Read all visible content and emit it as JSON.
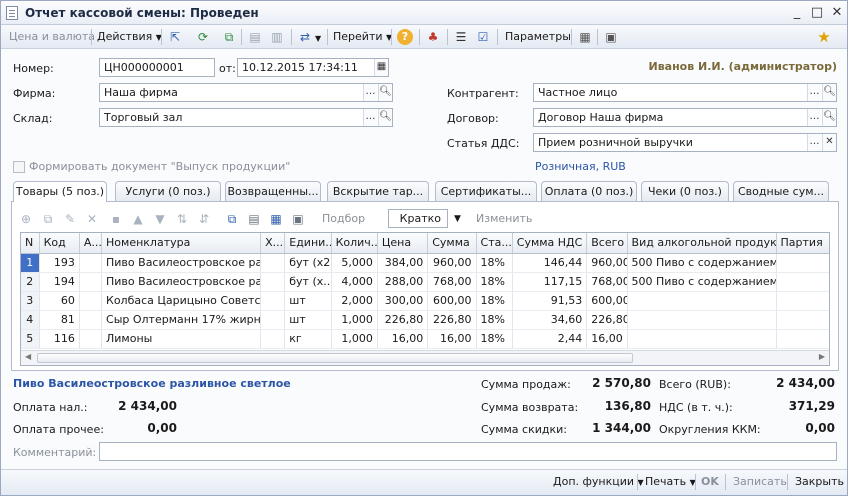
{
  "window": {
    "title": "Отчет кассовой смены: Проведен",
    "controls": {
      "minimize": "_",
      "maximize": "□",
      "close": "✕"
    }
  },
  "toolbar": {
    "price_currency": "Цена и валюта",
    "actions": "Действия",
    "goto": "Перейти",
    "parameters": "Параметры"
  },
  "header": {
    "number_label": "Номер:",
    "number_value": "ЦН000000001",
    "date_label": "от:",
    "date_value": "10.12.2015 17:34:11",
    "firm_label": "Фирма:",
    "firm_value": "Наша фирма",
    "warehouse_label": "Склад:",
    "warehouse_value": "Торговый зал",
    "user": "Иванов И.И. (администратор)",
    "counterparty_label": "Контрагент:",
    "counterparty_value": "Частное лицо",
    "contract_label": "Договор:",
    "contract_value": "Договор Наша фирма",
    "dds_label": "Статья ДДС:",
    "dds_value": "Прием розничной выручки",
    "checkbox_label": "Формировать документ \"Выпуск продукции\"",
    "price_type": "Розничная, RUB"
  },
  "tabs": [
    {
      "label": "Товары (5 поз.)"
    },
    {
      "label": "Услуги (0 поз.)"
    },
    {
      "label": "Возвращенны..."
    },
    {
      "label": "Вскрытие тар..."
    },
    {
      "label": "Сертификаты..."
    },
    {
      "label": "Оплата (0 поз.)"
    },
    {
      "label": "Чеки (0 поз.)"
    },
    {
      "label": "Сводные сум..."
    }
  ],
  "subtoolbar": {
    "selection": "Подбор",
    "view_mode": "Кратко",
    "change": "Изменить"
  },
  "table": {
    "columns": [
      "N",
      "Код",
      "А...",
      "Номенклатура",
      "Х...",
      "Едини...",
      "Колич...",
      "Цена",
      "Сумма",
      "Ста...",
      "Сумма НДС",
      "Всего",
      "Вид алкогольной продукц...",
      "Партия"
    ],
    "rows": [
      [
        "1",
        "193",
        "",
        "Пиво Василеостровское ра...",
        "",
        "бут (x2)",
        "5,000",
        "384,00",
        "960,00",
        "18%",
        "146,44",
        "960,00",
        "500 Пиво с содержанием ...",
        ""
      ],
      [
        "2",
        "194",
        "",
        "Пиво Василеостровское ра...",
        "",
        "бут (х...",
        "4,000",
        "288,00",
        "768,00",
        "18%",
        "117,15",
        "768,00",
        "500 Пиво с содержанием ...",
        ""
      ],
      [
        "3",
        "60",
        "",
        "Колбаса Царицыно Советск...",
        "",
        "шт",
        "2,000",
        "300,00",
        "600,00",
        "18%",
        "91,53",
        "600,00",
        "",
        ""
      ],
      [
        "4",
        "81",
        "",
        "Сыр Олтерманн 17% жирн н...",
        "",
        "шт",
        "1,000",
        "226,80",
        "226,80",
        "18%",
        "34,60",
        "226,80",
        "",
        ""
      ],
      [
        "5",
        "116",
        "",
        "Лимоны",
        "",
        "кг",
        "1,000",
        "16,00",
        "16,00",
        "18%",
        "2,44",
        "16,00",
        "",
        ""
      ]
    ]
  },
  "totals": {
    "product_name": "Пиво Василеостровское разливное светлое",
    "cash_label": "Оплата нал.:",
    "cash_value": "2 434,00",
    "other_label": "Оплата прочее:",
    "other_value": "0,00",
    "sales_label": "Сумма продаж:",
    "sales_value": "2 570,80",
    "return_label": "Сумма возврата:",
    "return_value": "136,80",
    "discount_label": "Сумма скидки:",
    "discount_value": "1 344,00",
    "total_label": "Всего (RUB):",
    "total_value": "2 434,00",
    "vat_label": "НДС (в т. ч.):",
    "vat_value": "371,29",
    "rounding_label": "Округления ККМ:",
    "rounding_value": "0,00",
    "comment_label": "Комментарий:"
  },
  "bottom": {
    "extra": "Доп. функции",
    "print": "Печать",
    "ok": "OK",
    "save": "Записать",
    "close": "Закрыть"
  },
  "colors": {
    "accent_blue": "#2c56a5",
    "user_color": "#7a6a3a",
    "selection": "#3f6fc7"
  }
}
